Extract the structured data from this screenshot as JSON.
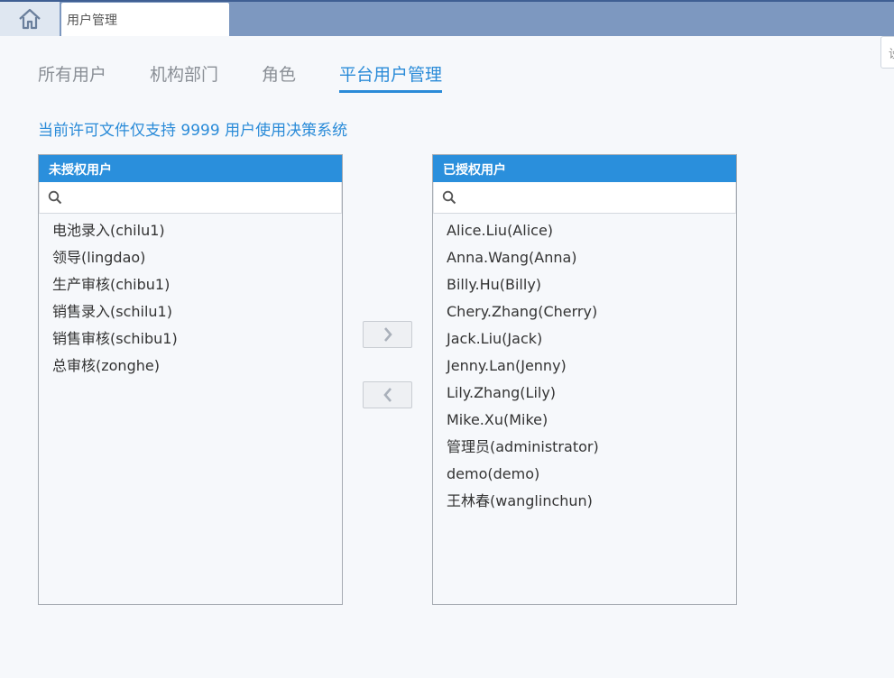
{
  "tabs": {
    "home_icon": "home-icon",
    "current_tab": "用户管理",
    "side_peek": "设"
  },
  "nav": {
    "items": [
      "所有用户",
      "机构部门",
      "角色",
      "平台用户管理"
    ],
    "active_index": 3
  },
  "license_notice": "当前许可文件仅支持 9999 用户使用决策系统",
  "unauthorized": {
    "title": "未授权用户",
    "search_placeholder": "",
    "users": [
      "电池录入(chilu1)",
      "领导(lingdao)",
      "生产审核(chibu1)",
      "销售录入(schilu1)",
      "销售审核(schibu1)",
      "总审核(zonghe)"
    ]
  },
  "authorized": {
    "title": "已授权用户",
    "search_placeholder": "",
    "users": [
      "Alice.Liu(Alice)",
      "Anna.Wang(Anna)",
      "Billy.Hu(Billy)",
      "Chery.Zhang(Cherry)",
      "Jack.Liu(Jack)",
      "Jenny.Lan(Jenny)",
      "Lily.Zhang(Lily)",
      "Mike.Xu(Mike)",
      "管理员(administrator)",
      "demo(demo)",
      "王林春(wanglinchun)"
    ]
  },
  "buttons": {
    "move_right": "›",
    "move_left": "‹"
  },
  "colors": {
    "accent": "#2a8bd8",
    "panel_header": "#2a8fdc",
    "topbar": "#7d98c0"
  }
}
